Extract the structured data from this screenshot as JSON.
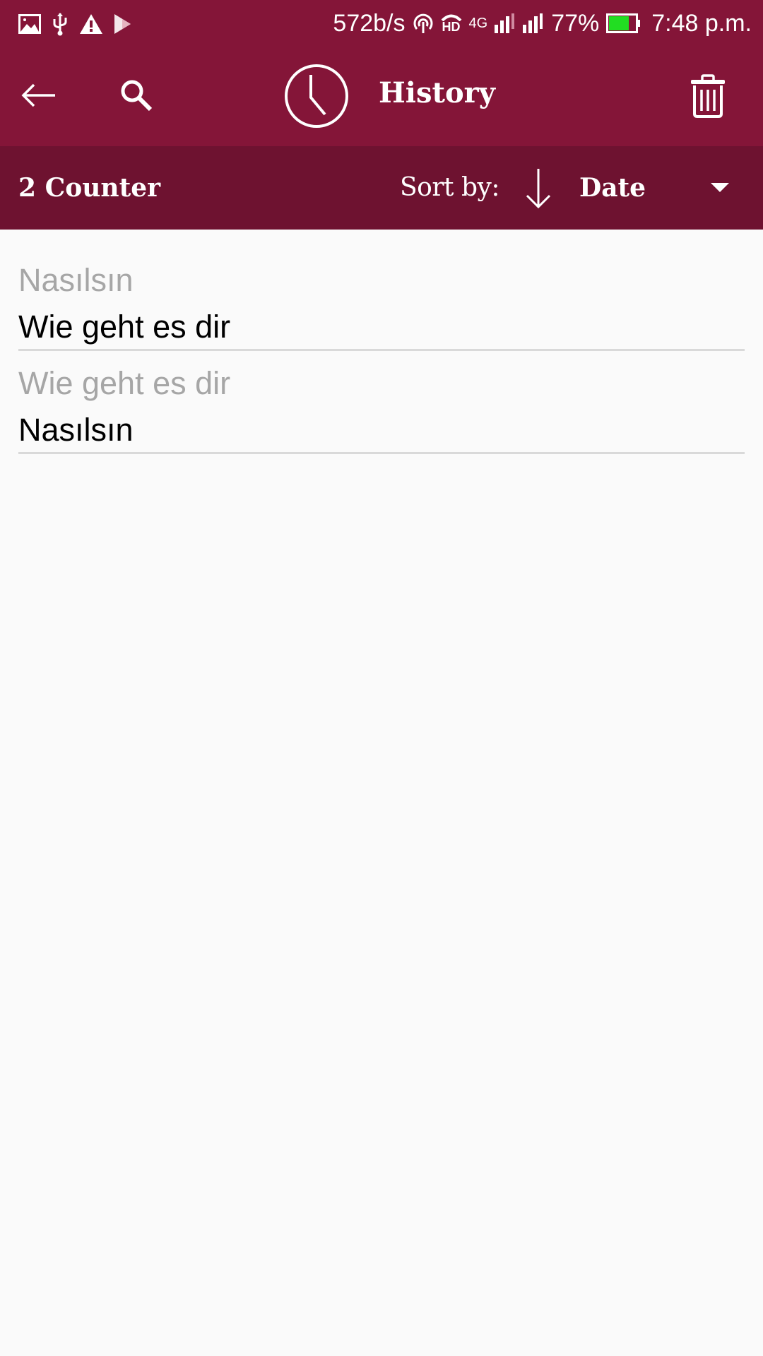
{
  "status_bar": {
    "left_icons": [
      "gallery-icon",
      "usb-icon",
      "warning-icon",
      "play-store-icon"
    ],
    "network_speed": "572b/s",
    "network_type": "4G",
    "hd_label": "HD",
    "battery_percent": "77%",
    "battery_level": 0.77,
    "time": "7:48 p.m."
  },
  "app_bar": {
    "back_icon": "arrow-left-icon",
    "search_icon": "search-icon",
    "title_icon": "clock-icon",
    "title": "History",
    "delete_icon": "trash-icon"
  },
  "sort_bar": {
    "counter_label": "2 Counter",
    "sort_label": "Sort by:",
    "sort_direction": "descending",
    "sort_value": "Date"
  },
  "history": [
    {
      "source": "Nasılsın",
      "translation": "Wie geht es dir"
    },
    {
      "source": "Wie geht es dir",
      "translation": "Nasılsın"
    }
  ],
  "colors": {
    "app_bar": "#841538",
    "sort_bar": "#6e1230",
    "background": "#fafafa",
    "source_text": "#a6a6a6",
    "translation_text": "#000000",
    "divider": "#d9d9d9",
    "battery_fill": "#22dd22"
  }
}
